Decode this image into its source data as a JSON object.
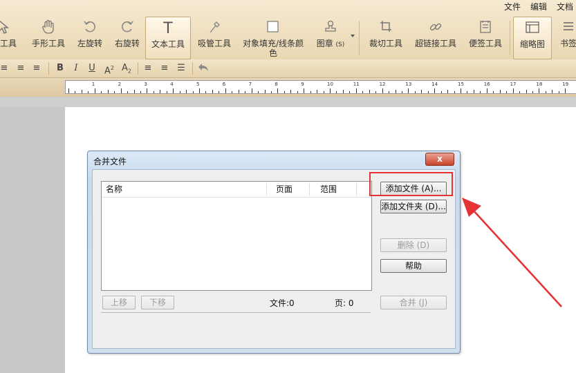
{
  "menu": [
    "文件",
    "编辑",
    "文档"
  ],
  "tools": [
    {
      "label": "像工具",
      "icon": "pointer-icon"
    },
    {
      "label": "手形工具",
      "icon": "hand-icon"
    },
    {
      "label": "左旋转",
      "icon": "rotate-left-icon"
    },
    {
      "label": "右旋转",
      "icon": "rotate-right-icon"
    },
    {
      "label": "文本工具",
      "icon": "text-icon",
      "active": true
    },
    {
      "label": "吸管工具",
      "icon": "eyedropper-icon"
    },
    {
      "label": "对象填充/线条颜色",
      "line1": "对象填充/线条颜",
      "line2": "色",
      "icon": "fill-icon"
    },
    {
      "label": "图章",
      "sub": "(S)",
      "icon": "stamp-icon"
    },
    {
      "label": "裁切工具",
      "icon": "crop-icon"
    },
    {
      "label": "超链接工具",
      "icon": "link-icon"
    },
    {
      "label": "便签工具",
      "icon": "note-icon"
    },
    {
      "label": "缩略图",
      "icon": "thumbnail-icon",
      "active": true
    },
    {
      "label": "书签",
      "icon": "bookmark-icon"
    }
  ],
  "ruler_numbers": [
    "1",
    "2",
    "3",
    "4",
    "5",
    "6",
    "7",
    "8",
    "9",
    "10",
    "11",
    "12",
    "13",
    "14",
    "15",
    "16",
    "17",
    "18",
    "19"
  ],
  "dialog": {
    "title": "合并文件",
    "close": "x",
    "columns": {
      "name": "名称",
      "pages": "页面",
      "range": "范围"
    },
    "buttons": {
      "add_file": "添加文件 (A)...",
      "add_folder": "添加文件夹 (D)...",
      "delete": "删除 (D)",
      "help": "帮助",
      "up": "上移",
      "down": "下移",
      "merge": "合并 (J)"
    },
    "status": {
      "files": "文件:0",
      "pages": "页: 0"
    }
  },
  "colors": {
    "toolbar": "#ead7b2",
    "highlight": "#e53335",
    "arrow": "#e53335"
  }
}
